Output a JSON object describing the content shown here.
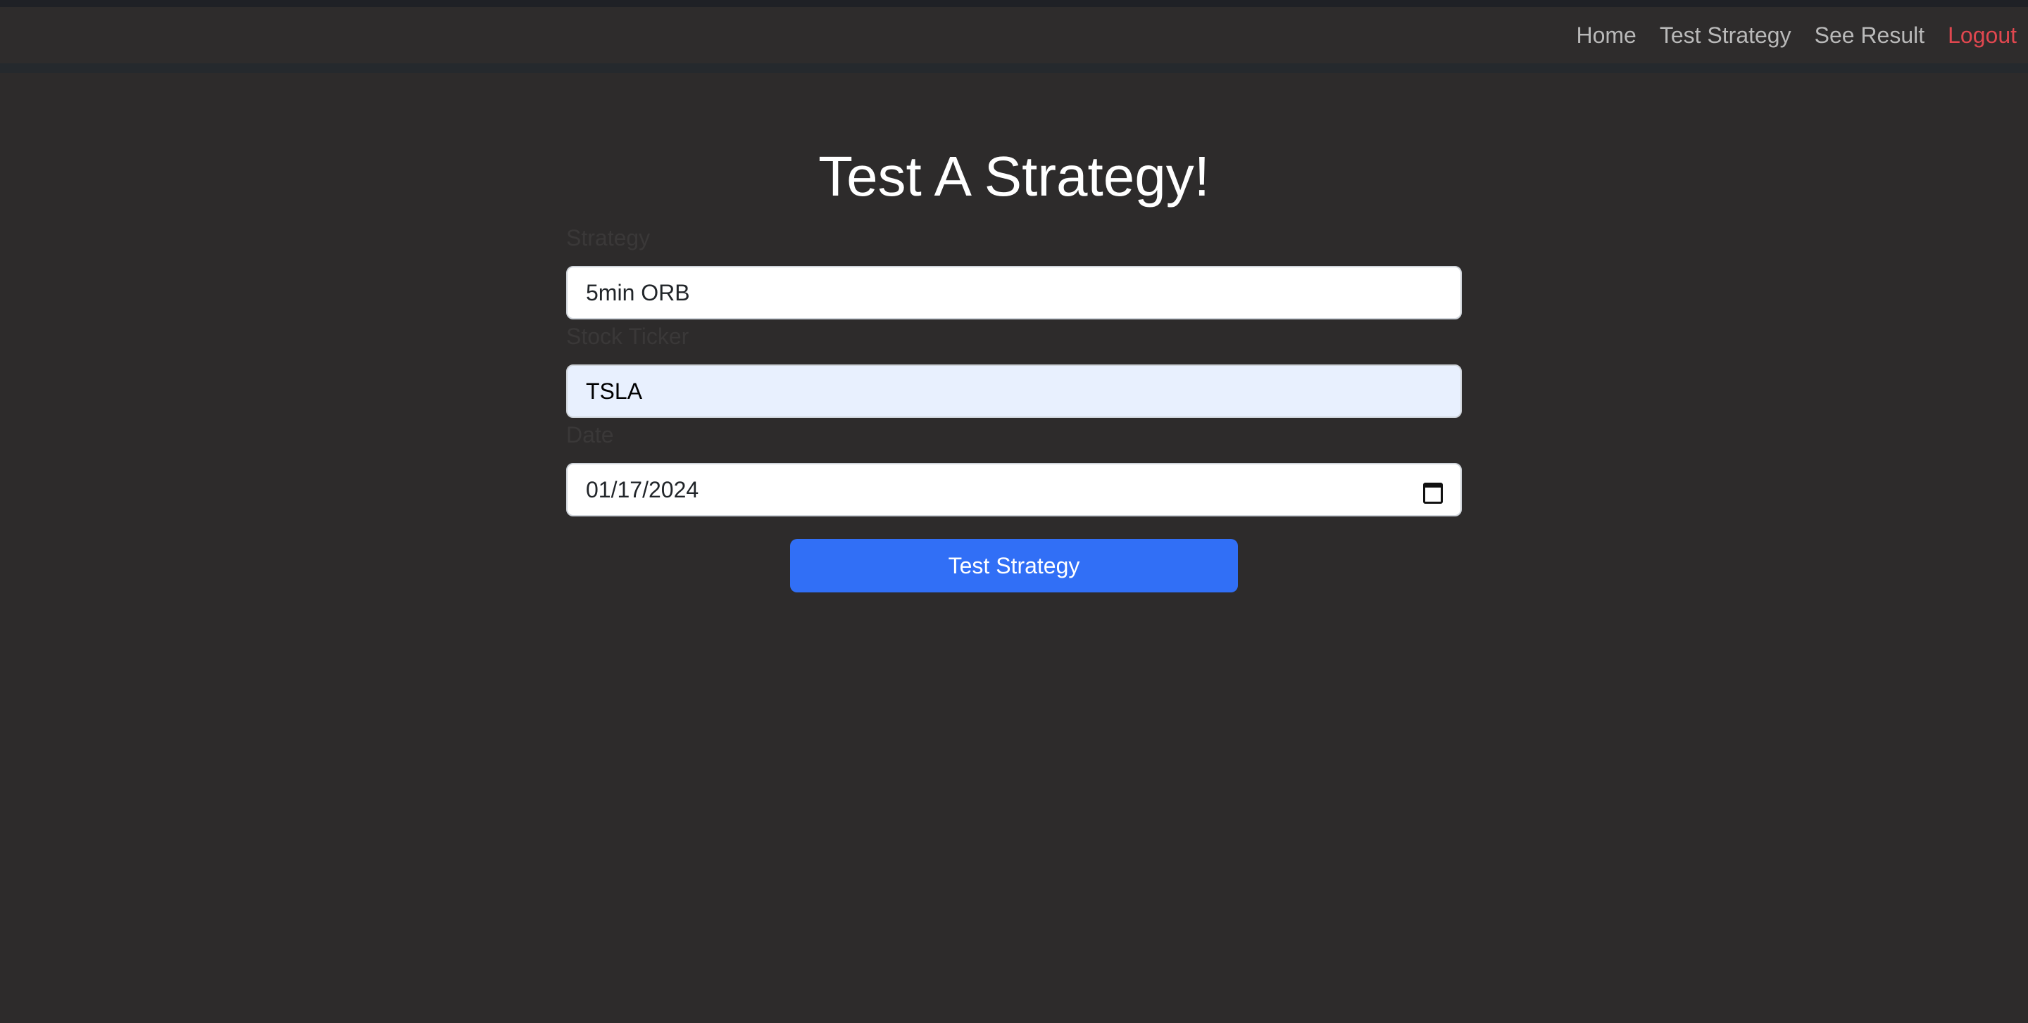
{
  "nav": {
    "links": [
      {
        "label": "Home"
      },
      {
        "label": "Test Strategy"
      },
      {
        "label": "See Result"
      },
      {
        "label": "Logout",
        "color": "#e0474f"
      }
    ]
  },
  "main": {
    "title": "Test A Strategy!",
    "form": {
      "strategy": {
        "label": "Strategy",
        "value": "5min ORB"
      },
      "ticker": {
        "label": "Stock Ticker",
        "value": "TSLA"
      },
      "date": {
        "label": "Date",
        "value": "01/17/2024",
        "icon": "calendar-icon"
      },
      "submit_label": "Test Strategy"
    }
  },
  "colors": {
    "background": "#2d2b2b",
    "navbar": "#2e2c2c",
    "accent": "#316ff6",
    "logout": "#e0474f",
    "autofill": "#e8f0fe"
  }
}
